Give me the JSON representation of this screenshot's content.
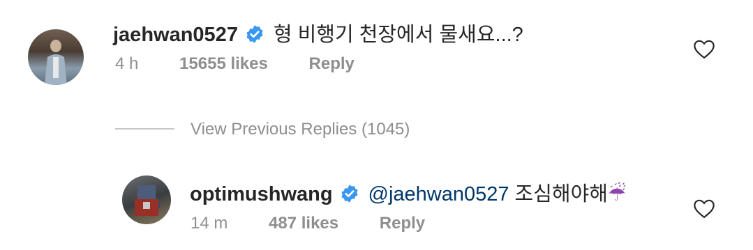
{
  "comments": [
    {
      "username": "jaehwan0527",
      "verified": true,
      "mention": "",
      "text": "형 비행기 천장에서 물새요...?",
      "time": "4 h",
      "likes": "15655 likes",
      "reply_label": "Reply",
      "emoji": ""
    },
    {
      "username": "optimushwang",
      "verified": true,
      "mention": "@jaehwan0527",
      "text": " 조심해야해",
      "time": "14 m",
      "likes": "487 likes",
      "reply_label": "Reply",
      "emoji": "☔"
    }
  ],
  "replies_toggle": {
    "label": "View Previous Replies (1045)"
  },
  "colors": {
    "verified": "#3897f0",
    "mention": "#00376b",
    "meta": "#8e8e8e"
  },
  "icons": [
    "verified-badge-icon",
    "heart-icon",
    "umbrella-emoji-icon"
  ]
}
